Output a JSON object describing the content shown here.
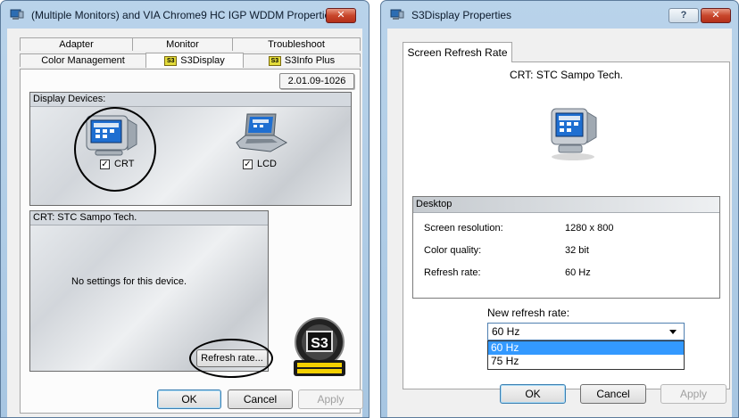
{
  "window1": {
    "title": "(Multiple Monitors) and VIA Chrome9 HC IGP WDDM  Properties",
    "close_glyph": "✕",
    "tabs_row1": [
      {
        "label": "Adapter"
      },
      {
        "label": "Monitor"
      },
      {
        "label": "Troubleshoot"
      }
    ],
    "tabs_row2": [
      {
        "label": "Color Management"
      },
      {
        "label": "S3Display",
        "active": true
      },
      {
        "label": "S3Info Plus"
      }
    ],
    "tab_icon_text": "S3",
    "version": "2.01.09-1026",
    "display_devices_label": "Display Devices:",
    "devices": [
      {
        "name": "CRT",
        "checked": true,
        "check_glyph": "✓"
      },
      {
        "name": "LCD",
        "checked": true,
        "check_glyph": "✓"
      }
    ],
    "crt_header": "CRT: STC Sampo Tech.",
    "no_settings": "No settings for this device.",
    "refresh_button": "Refresh rate...",
    "logo_text": "S3",
    "buttons": {
      "ok": "OK",
      "cancel": "Cancel",
      "apply": "Apply"
    }
  },
  "window2": {
    "title": "S3Display Properties",
    "help_glyph": "?",
    "close_glyph": "✕",
    "tab": "Screen Refresh Rate",
    "device_title": "CRT: STC Sampo Tech.",
    "desktop_header": "Desktop",
    "rows": [
      {
        "key": "Screen resolution:",
        "value": "1280 x 800"
      },
      {
        "key": "Color quality:",
        "value": "32 bit"
      },
      {
        "key": "Refresh rate:",
        "value": "60 Hz"
      }
    ],
    "new_refresh_label": "New refresh rate:",
    "selected_rate": "60 Hz",
    "options": [
      "60 Hz",
      "75 Hz"
    ],
    "buttons": {
      "ok": "OK",
      "cancel": "Cancel",
      "apply": "Apply"
    }
  }
}
